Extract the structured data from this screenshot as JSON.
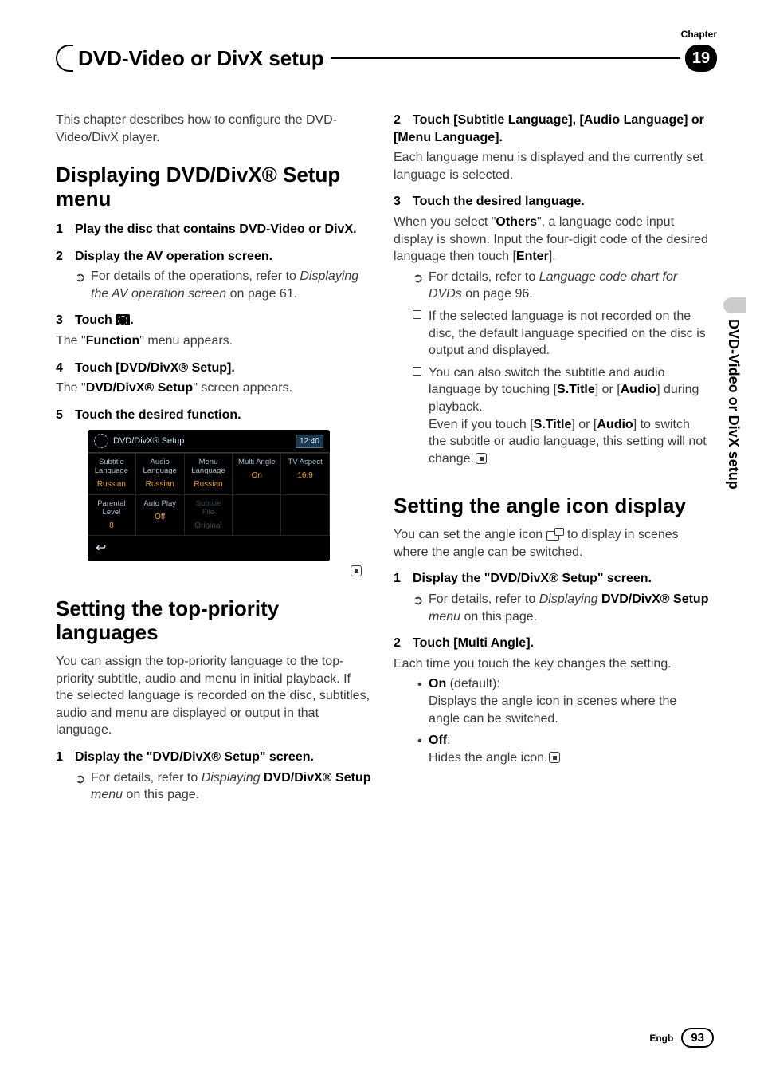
{
  "chapter_label": "Chapter",
  "chapter_num": "19",
  "header_title": "DVD-Video or DivX setup",
  "side_tab": "DVD-Video or DivX setup",
  "footer": {
    "lang": "Engb",
    "page": "93"
  },
  "left": {
    "intro": "This chapter describes how to configure the DVD-Video/DivX player.",
    "h1": "Displaying DVD/DivX® Setup menu",
    "s1": {
      "num": "1",
      "text": "Play the disc that contains DVD-Video or DivX."
    },
    "s2": {
      "num": "2",
      "text": "Display the AV operation screen.",
      "sub": {
        "pre": "For details of the operations, refer to ",
        "ital": "Displaying the AV operation screen",
        "post": " on page 61."
      }
    },
    "s3": {
      "num": "3",
      "pre": "Touch ",
      "post": ".",
      "body_pre": "The \"",
      "body_bold": "Function",
      "body_post": "\" menu appears."
    },
    "s4": {
      "num": "4",
      "text": "Touch [DVD/DivX® Setup].",
      "body_pre": "The \"",
      "body_bold": "DVD/DivX® Setup",
      "body_post": "\" screen appears."
    },
    "s5": {
      "num": "5",
      "text": "Touch the desired function."
    },
    "screenshot": {
      "title": "DVD/DivX® Setup",
      "time": "12:40",
      "r1": [
        {
          "lbl1": "Subtitle",
          "lbl2": "Language",
          "val": "Russian"
        },
        {
          "lbl1": "Audio",
          "lbl2": "Language",
          "val": "Russian"
        },
        {
          "lbl1": "Menu",
          "lbl2": "Language",
          "val": "Russian"
        },
        {
          "lbl1": "Multi Angle",
          "lbl2": "",
          "val": "On"
        },
        {
          "lbl1": "TV Aspect",
          "lbl2": "",
          "val": "16:9"
        }
      ],
      "r2": [
        {
          "lbl1": "Parental",
          "lbl2": "Level",
          "val": "8"
        },
        {
          "lbl1": "Auto Play",
          "lbl2": "",
          "val": "Off"
        },
        {
          "lbl1": "Subtitle",
          "lbl2": "File",
          "val": "Original",
          "dim": true
        }
      ]
    },
    "h2": "Setting the top-priority languages",
    "p2": "You can assign the top-priority language to the top-priority subtitle, audio and menu in initial playback. If the selected language is recorded on the disc, subtitles, audio and menu are displayed or output in that language.",
    "s6": {
      "num": "1",
      "text": "Display the \"DVD/DivX® Setup\" screen.",
      "sub": {
        "pre": "For details, refer to ",
        "ital1": "Displaying ",
        "bold": "DVD/DivX® Setup",
        "ital2": " menu",
        "post": " on this page."
      }
    }
  },
  "right": {
    "s2": {
      "num": "2",
      "text": "Touch [Subtitle Language], [Audio Language] or [Menu Language].",
      "body": "Each language menu is displayed and the currently set language is selected."
    },
    "s3": {
      "num": "3",
      "text": "Touch the desired language.",
      "body_pre": "When you select \"",
      "body_bold": "Others",
      "body_post": "\", a language code input display is shown. Input the four-digit code of the desired language then touch [",
      "body_bold2": "Enter",
      "body_post2": "].",
      "sub1": {
        "pre": "For details, refer to ",
        "ital": "Language code chart for DVDs",
        "post": " on page 96."
      },
      "sub2": "If the selected language is not recorded on the disc, the default language specified on the disc is output and displayed.",
      "sub3_pre": "You can also switch the subtitle and audio language by touching [",
      "sub3_b1": "S.Title",
      "sub3_mid1": "] or [",
      "sub3_b2": "Audio",
      "sub3_mid2": "] during playback.",
      "sub3_line2_pre": "Even if you touch [",
      "sub3_line2_b1": "S.Title",
      "sub3_line2_mid": "] or [",
      "sub3_line2_b2": "Audio",
      "sub3_line2_post": "] to switch the subtitle or audio language, this setting will not change."
    },
    "h2": "Setting the angle icon display",
    "p2_pre": "You can set the angle icon ",
    "p2_post": " to display in scenes where the angle can be switched.",
    "s4": {
      "num": "1",
      "text": "Display the \"DVD/DivX® Setup\" screen.",
      "sub": {
        "pre": "For details, refer to ",
        "ital1": "Displaying ",
        "bold": "DVD/DivX® Setup",
        "ital2": " menu",
        "post": " on this page."
      }
    },
    "s5": {
      "num": "2",
      "text": "Touch [Multi Angle].",
      "body": "Each time you touch the key changes the setting.",
      "on_label": "On",
      "on_note": " (default):",
      "on_body": "Displays the angle icon in scenes where the angle can be switched.",
      "off_label": "Off",
      "off_note": ":",
      "off_body": "Hides the angle icon."
    }
  }
}
